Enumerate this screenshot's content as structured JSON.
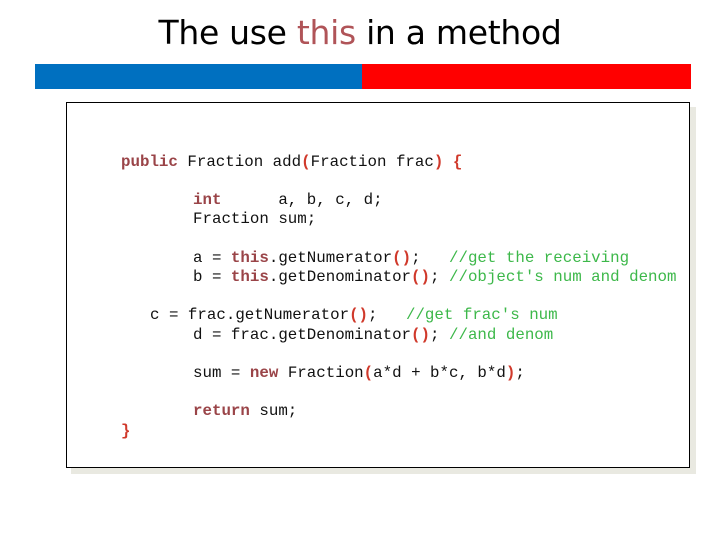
{
  "slide": {
    "title_before": "The use ",
    "title_highlight": "this",
    "title_after": " in a method",
    "colors": {
      "bar_left": "#0070c0",
      "bar_right": "#ff0000",
      "keyword": "#9a4448",
      "paren": "#d0392b",
      "comment": "#3db84a",
      "highlight": "#b05458"
    }
  },
  "code": {
    "l1": {
      "kw": "public",
      "t1": " Fraction add",
      "p1": "(",
      "t2": "Fraction frac",
      "p2": ")",
      "t3": " ",
      "p3": "{"
    },
    "l2": {
      "kw": "int",
      "t1": "      a, b, c, d;"
    },
    "l3": {
      "t1": "Fraction sum;"
    },
    "l4": {
      "t1": "a = ",
      "kw": "this",
      "t2": ".getNumerator",
      "p1": "()",
      "t3": ";   ",
      "cm": "//get the receiving"
    },
    "l5": {
      "t1": "b = ",
      "kw": "this",
      "t2": ".getDenominator",
      "p1": "()",
      "t3": "; ",
      "cm": "//object's num and denom"
    },
    "l6": {
      "t1": "c = frac.getNumerator",
      "p1": "()",
      "t3": ";   ",
      "cm": "//get frac's num"
    },
    "l7": {
      "t1": "d = frac.getDenominator",
      "p1": "()",
      "t3": "; ",
      "cm": "//and denom"
    },
    "l8": {
      "t1": "sum = ",
      "kw": "new",
      "t2": " Fraction",
      "p1": "(",
      "t3": "a*d + b*c, b*d",
      "p2": ")",
      "t4": ";"
    },
    "l9": {
      "kw": "return",
      "t1": " sum;"
    },
    "l10": {
      "p1": "}"
    }
  }
}
